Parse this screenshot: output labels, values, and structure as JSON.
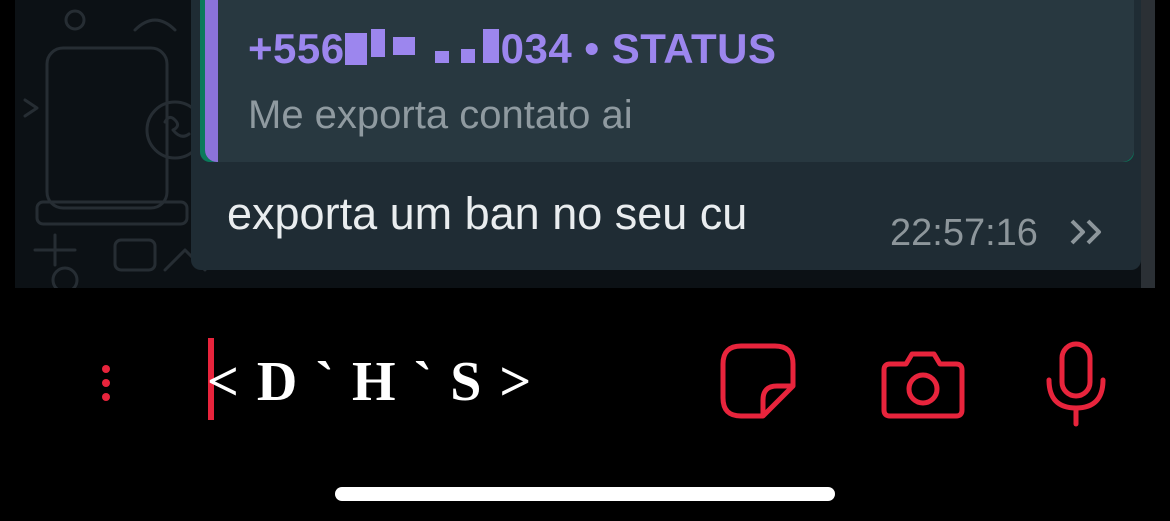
{
  "message": {
    "quoted": {
      "sender_prefix": "+556",
      "sender_suffix": "034 • STATUS",
      "text": "Me exporta contato ai"
    },
    "text": "exporta um ban no seu cu",
    "time": "22:57:16",
    "status_icon": "double-check-icon"
  },
  "composer": {
    "value": "< D ` H ` S >",
    "menu_icon": "more-vertical-icon",
    "sticker_icon": "sticker-icon",
    "camera_icon": "camera-icon",
    "mic_icon": "microphone-icon"
  },
  "colors": {
    "accent": "#e8243c",
    "quote_name": "#9c86ee",
    "bubble": "#1f2c34"
  }
}
